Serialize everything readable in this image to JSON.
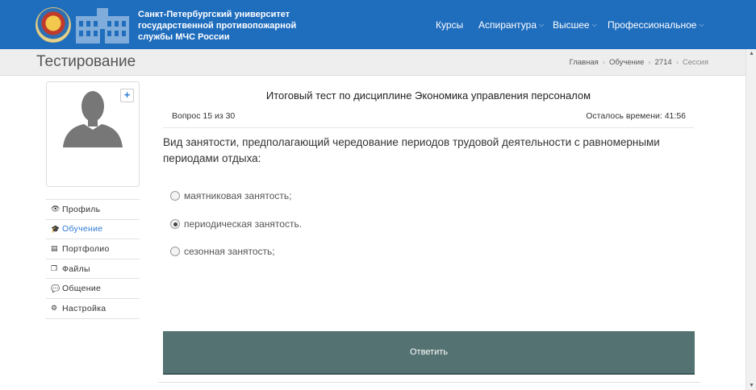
{
  "header": {
    "org_name": "Санкт-Петербургский университет государственной противопожарной службы МЧС России",
    "nav": [
      {
        "label": "Курсы",
        "dropdown": false
      },
      {
        "label": "Аспирантура",
        "dropdown": true
      },
      {
        "label": "Высшее",
        "dropdown": true
      },
      {
        "label": "Профессиональное",
        "dropdown": true
      }
    ]
  },
  "subheader": {
    "page_title": "Тестирование",
    "breadcrumb": [
      "Главная",
      "Обучение",
      "2714",
      "Сессия"
    ]
  },
  "sidebar": {
    "add_photo_label": "+",
    "menu": [
      {
        "icon": "eye-icon",
        "label": "Профиль",
        "active": false
      },
      {
        "icon": "graduation-cap-icon",
        "label": "Обучение",
        "active": true
      },
      {
        "icon": "portfolio-icon",
        "label": "Портфолио",
        "active": false
      },
      {
        "icon": "files-icon",
        "label": "Файлы",
        "active": false
      },
      {
        "icon": "comments-icon",
        "label": "Общение",
        "active": false
      },
      {
        "icon": "gears-icon",
        "label": "Настройка",
        "active": false
      }
    ]
  },
  "test": {
    "title": "Итоговый тест по дисциплине Экономика управления персоналом",
    "question_counter": "Вопрос 15 из 30",
    "time_left": "Осталось времени: 41:56",
    "question": "Вид занятости, предполагающий чередование периодов трудовой деятельности с равномерными периодами отдыха:",
    "options": [
      {
        "label": "маятниковая занятость;",
        "selected": false
      },
      {
        "label": "периодическая занятость.",
        "selected": true
      },
      {
        "label": "сезонная занятость;",
        "selected": false
      }
    ],
    "submit_label": "Ответить"
  },
  "colors": {
    "header_bg": "#1f6dbd",
    "active_link": "#2d7bd6",
    "submit_bg": "#547272"
  }
}
